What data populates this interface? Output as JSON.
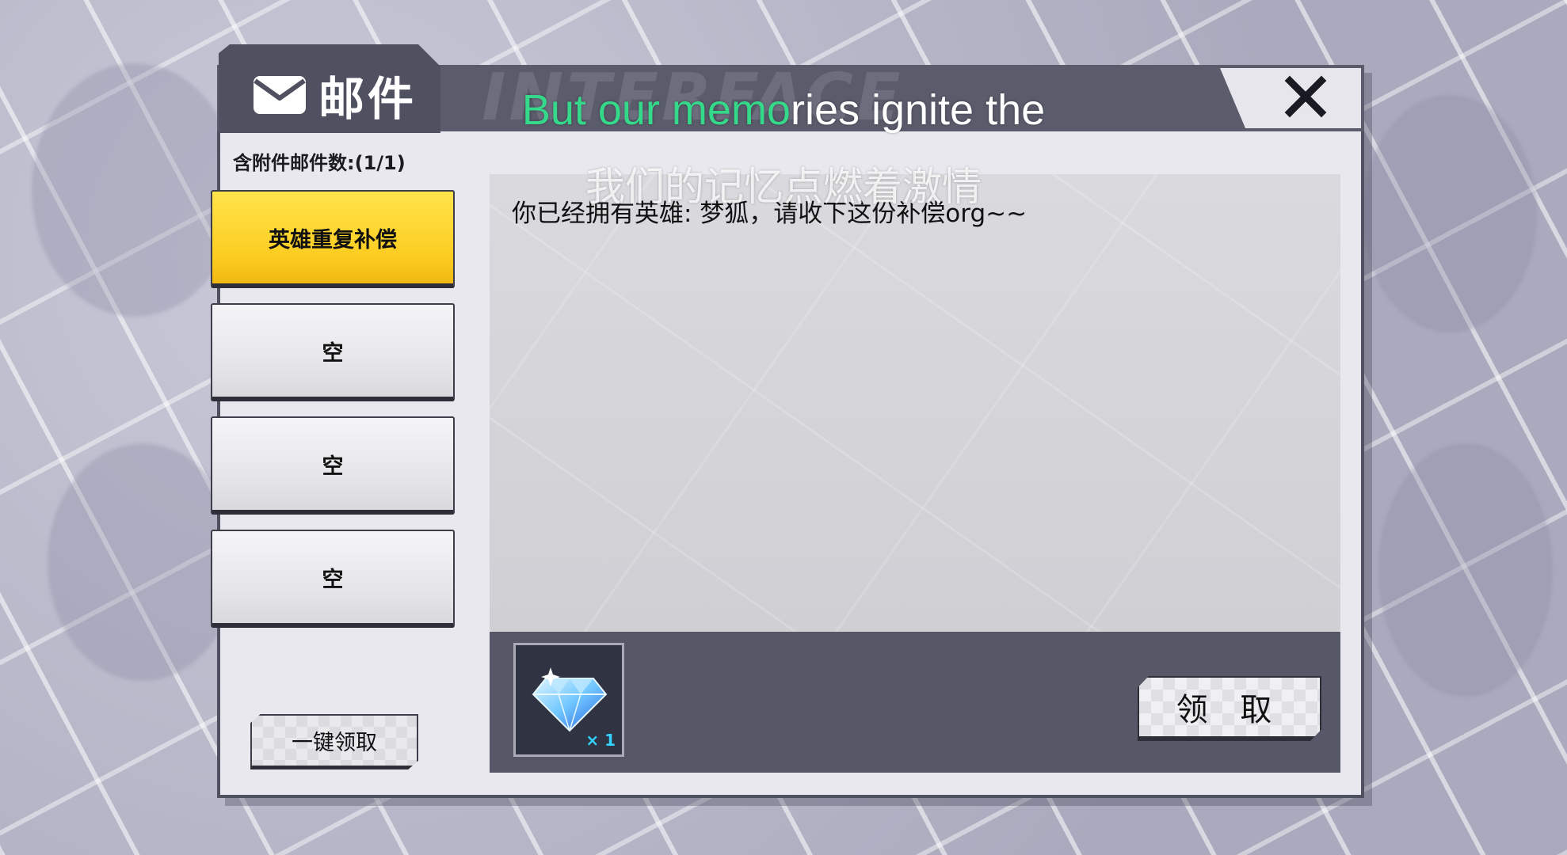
{
  "header": {
    "title": "邮件",
    "deco_text": "INTERFACE",
    "close_label": "✕"
  },
  "sidebar": {
    "attachment_count": "含附件邮件数:(1/1)",
    "items": [
      {
        "label": "英雄重复补偿",
        "active": true
      },
      {
        "label": "空",
        "active": false
      },
      {
        "label": "空",
        "active": false
      },
      {
        "label": "空",
        "active": false
      }
    ],
    "collect_all_label": "一键领取"
  },
  "mail": {
    "body": "你已经拥有英雄: 梦狐，请收下这份补偿org~~",
    "attachment": {
      "icon": "diamond-icon",
      "quantity": "× 1"
    },
    "claim_label": "领 取"
  },
  "subtitles": {
    "en_highlight": "But our memo",
    "en_rest": "ries ignite the",
    "zh": "我们的记忆点燃着激情"
  },
  "colors": {
    "active_item": "#fccd22",
    "header": "#5a5b6b",
    "subtitle_highlight": "#35d98a",
    "quantity": "#34d2ff"
  }
}
